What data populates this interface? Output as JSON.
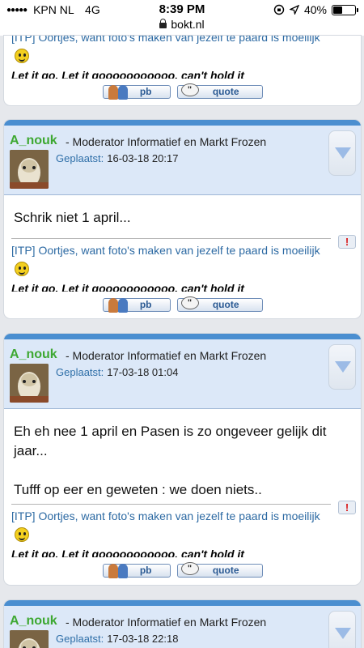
{
  "status_bar": {
    "carrier": "KPN NL",
    "network": "4G",
    "time": "8:39 PM",
    "battery": "40%",
    "battery_level": 0.4,
    "icons": [
      "orientation-lock-icon",
      "location-arrow-icon",
      "battery-icon"
    ]
  },
  "browser": {
    "url": "bokt.nl",
    "lock_icon": "lock-icon"
  },
  "signature": {
    "link_text": "[ITP] Oortjes, want foto's maken van jezelf te paard is moeilijk",
    "song_text": "Let it go. Let it gooooooooooo. can't hold it"
  },
  "buttons": {
    "pb": "pb",
    "quote": "quote"
  },
  "posts": [
    {
      "author": "A_nouk",
      "role": "- Moderator Informatief en Markt Frozen",
      "posted_label": "Geplaatst:",
      "date": "16-03-18 20:17",
      "message": "Schrik niet 1 april..."
    },
    {
      "author": "A_nouk",
      "role": "- Moderator Informatief en Markt Frozen",
      "posted_label": "Geplaatst:",
      "date": "17-03-18 01:04",
      "message_line1": "Eh eh nee 1 april en Pasen is zo ongeveer gelijk dit jaar...",
      "message_line2": "Tufff op eer en geweten : we doen niets.."
    },
    {
      "author": "A_nouk",
      "role": "- Moderator Informatief en Markt Frozen",
      "posted_label": "Geplaatst:",
      "date": "17-03-18 22:18"
    }
  ],
  "colors": {
    "author": "#3ea832",
    "header_bg": "#dce8f8",
    "top_strip": "#4a8ed0",
    "link": "#2d6aa3",
    "report": "#d81818"
  }
}
